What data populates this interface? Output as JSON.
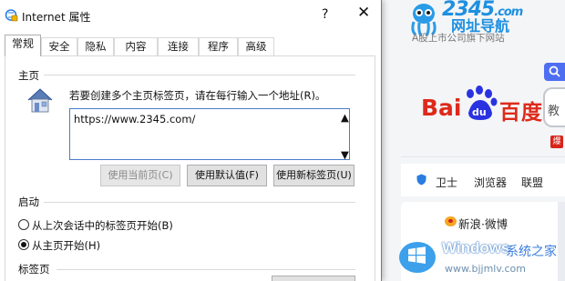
{
  "dialog": {
    "title": "Internet 属性",
    "help_label": "?",
    "close_label": "✕",
    "tabs": [
      {
        "label": "常规",
        "active": true
      },
      {
        "label": "安全"
      },
      {
        "label": "隐私"
      },
      {
        "label": "内容"
      },
      {
        "label": "连接"
      },
      {
        "label": "程序"
      },
      {
        "label": "高级"
      }
    ],
    "homepage": {
      "group_label": "主页",
      "description": "若要创建多个主页标签页，请在每行输入一个地址(R)。",
      "url_value": "https://www.2345.com/",
      "buttons": {
        "use_current": "使用当前页(C)",
        "use_default": "使用默认值(F)",
        "use_new_tab": "使用新标签页(U)"
      }
    },
    "startup": {
      "group_label": "启动",
      "options": [
        {
          "label": "从上次会话中的标签页开始(B)",
          "selected": false
        },
        {
          "label": "从主页开始(H)",
          "selected": true
        }
      ]
    },
    "tabs_section": {
      "group_label": "标签页"
    }
  },
  "background_page": {
    "site_brand": "2345",
    "site_brand_suffix": ".com",
    "site_name": "网址导航",
    "site_tagline": "A股上市公司旗下网站",
    "search_engine_logo_left": "Bai",
    "search_engine_logo_paw": "du",
    "search_engine_logo_right": "百度",
    "search_field_text": "教",
    "red_badge": "爆",
    "nav_items": [
      "卫士",
      "浏览器",
      "联盟"
    ],
    "weibo_label": "新浪·微博",
    "watermark_brand": "Windows",
    "watermark_cn": "系统之家",
    "watermark_url": "www.bjjmlv.com",
    "colors": {
      "brand_blue": "#1e90e0",
      "baidu_red": "#de2a1a",
      "baidu_blue": "#2932e1",
      "search_blue": "#4e6ef2"
    }
  }
}
